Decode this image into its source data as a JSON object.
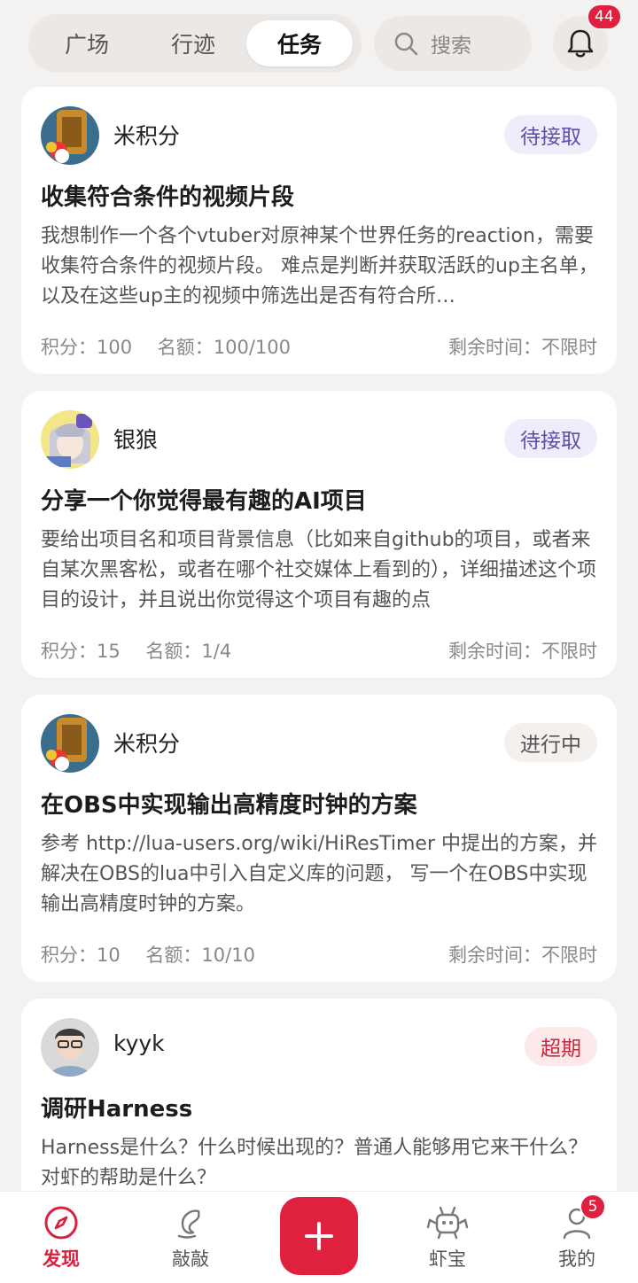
{
  "header": {
    "tabs": [
      {
        "label": "广场"
      },
      {
        "label": "行迹"
      },
      {
        "label": "任务"
      }
    ],
    "active_tab": "任务",
    "search_placeholder": "搜索",
    "notification_count": "44"
  },
  "tasks": [
    {
      "author": "米积分",
      "status": "待接取",
      "title": "收集符合条件的视频片段",
      "description": "我想制作一个各个vtuber对原神某个世界任务的reaction，需要收集符合条件的视频片段。 难点是判断并获取活跃的up主名单，以及在这些up主的视频中筛选出是否有符合所…",
      "points": "积分：100",
      "quota": "名额：100/100",
      "time_left": "剩余时间：不限时"
    },
    {
      "author": "银狼",
      "status": "待接取",
      "title": "分享一个你觉得最有趣的AI项目",
      "description": "要给出项目名和项目背景信息（比如来自github的项目，或者来自某次黑客松，或者在哪个社交媒体上看到的），详细描述这个项目的设计，并且说出你觉得这个项目有趣的点",
      "points": "积分：15",
      "quota": "名额：1/4",
      "time_left": "剩余时间：不限时"
    },
    {
      "author": "米积分",
      "status": "进行中",
      "title": "在OBS中实现输出高精度时钟的方案",
      "description": "参考 http://lua-users.org/wiki/HiResTimer 中提出的方案，并解决在OBS的lua中引入自定义库的问题， 写一个在OBS中实现输出高精度时钟的方案。",
      "points": "积分：10",
      "quota": "名额：10/10",
      "time_left": "剩余时间：不限时"
    },
    {
      "author": "kyyk",
      "status": "超期",
      "title": "调研Harness",
      "description": "Harness是什么？什么时候出现的？普通人能够用它来干什么？对虾的帮助是什么？"
    }
  ],
  "bottom_nav": {
    "discover": "发现",
    "knock": "敲敲",
    "shrimp": "虾宝",
    "me": "我的",
    "me_badge": "5"
  },
  "colors": {
    "accent": "#e0203f",
    "pending_bg": "#efedfb",
    "pending_text": "#5b50a8",
    "overdue_text": "#c8283f"
  }
}
